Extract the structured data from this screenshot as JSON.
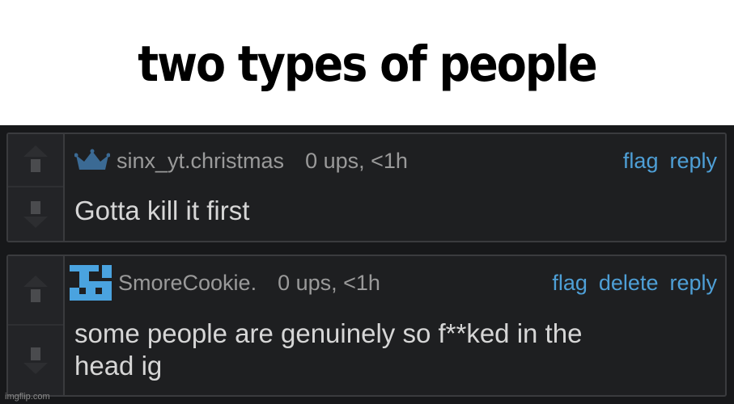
{
  "caption": "two types of people",
  "comments": [
    {
      "username": "sinx_yt.christmas",
      "meta": "0 ups, <1h",
      "actions": [
        "flag",
        "reply"
      ],
      "text": "Gotta kill it first",
      "avatar_icon": "crown-icon"
    },
    {
      "username": "SmoreCookie.",
      "meta": "0 ups, <1h",
      "actions": [
        "flag",
        "delete",
        "reply"
      ],
      "text_lines": [
        "some people are genuinely so f**ked in the",
        "head ig"
      ],
      "avatar_icon": "pixel-avatar-icon"
    }
  ],
  "watermark": "imgflip.com",
  "colors": {
    "link": "#4e9fd6",
    "crown": "#3b6a94",
    "avatar": "#4aa3df"
  }
}
